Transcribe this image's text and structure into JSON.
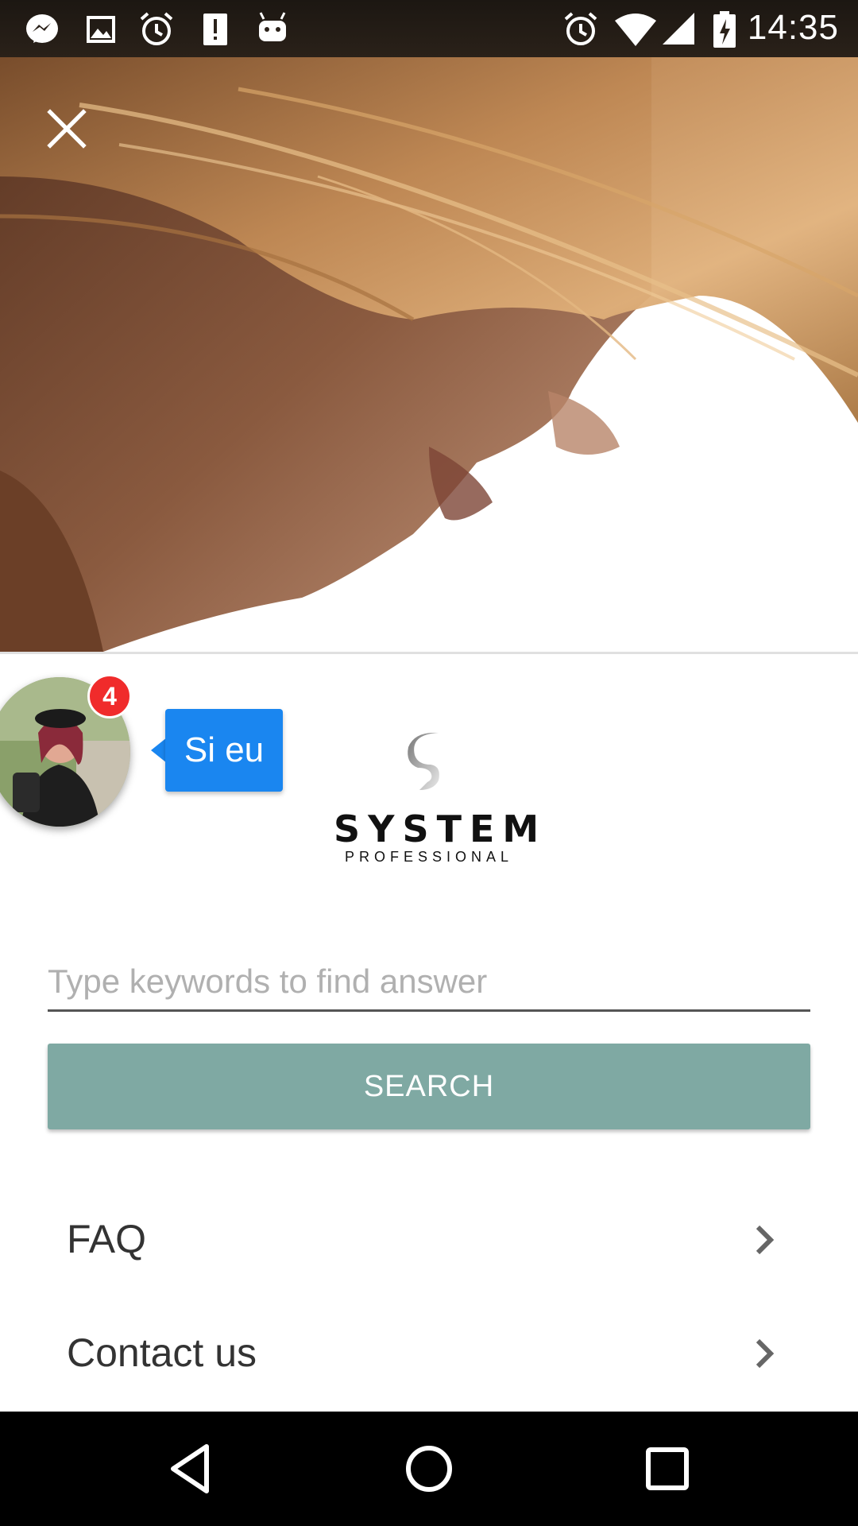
{
  "status_bar": {
    "time": "14:35",
    "left_icons": [
      "messenger-icon",
      "image-icon",
      "alarm-icon",
      "alert-icon",
      "android-icon"
    ],
    "right_icons": [
      "alarm-icon",
      "wifi-icon",
      "signal-icon",
      "battery-icon"
    ]
  },
  "chat_head": {
    "badge_count": "4",
    "bubble_text": "Si eu"
  },
  "logo": {
    "word": "SYSTEM",
    "sub": "PROFESSIONAL"
  },
  "search": {
    "placeholder": "Type keywords to find answer",
    "button_label": "SEARCH"
  },
  "menu": {
    "items": [
      {
        "label": "FAQ"
      },
      {
        "label": "Contact us"
      }
    ]
  },
  "colors": {
    "search_button": "#7fa9a3",
    "bubble": "#1a86f0",
    "badge": "#f02b2b"
  }
}
